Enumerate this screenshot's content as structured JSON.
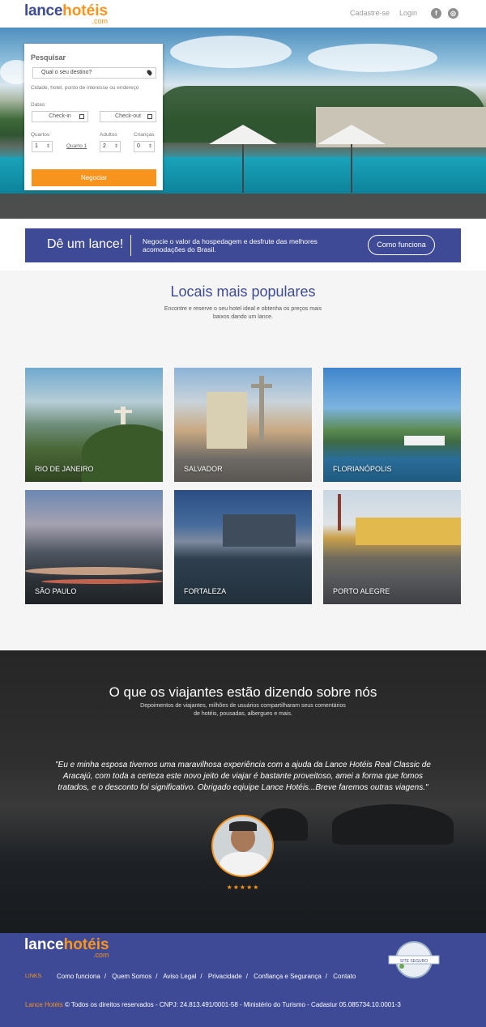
{
  "header": {
    "logo": {
      "part1": "lance",
      "part2": "hotéis",
      "part3": ".com"
    },
    "signup": "Cadastre-se",
    "login": "Login",
    "social": [
      {
        "name": "facebook",
        "glyph": "f"
      },
      {
        "name": "instagram",
        "glyph": "◎"
      }
    ]
  },
  "search": {
    "title": "Pesquisar",
    "destination_placeholder": "Qual o seu destino?",
    "destination_hint": "Cidade, hotel, ponto de interesse ou endereço",
    "dates_label": "Datas:",
    "checkin": "Check-in",
    "checkout": "Check-out",
    "rooms_label": "Quartos",
    "adults_label": "Adultos",
    "children_label": "Crianças",
    "rooms_value": "1",
    "adults_value": "2",
    "children_value": "0",
    "room_link": "Quarto 1",
    "submit": "Negociar"
  },
  "banner": {
    "title": "Dê um lance!",
    "text": "Negocie o valor da hospedagem e desfrute das melhores acomodações do Brasil.",
    "button": "Como funciona"
  },
  "popular": {
    "title": "Locais mais populares",
    "subtitle": "Encontre e reserve o seu hotel ideal e obtenha os preços mais baixos dando um lance.",
    "cities": [
      "RIO DE JANEIRO",
      "SALVADOR",
      "FLORIANÓPOLIS",
      "SÃO PAULO",
      "FORTALEZA",
      "PORTO ALEGRE"
    ]
  },
  "testimonials": {
    "title": "O que os viajantes estão dizendo sobre nós",
    "subtitle": "Depoimentos de viajantes, milhões de usuários compartilharam seus comentários de hotéis, pousadas, albergues e mais.",
    "quote": "\"Eu e minha esposa tivemos uma maravilhosa experiência com a ajuda da Lance Hotéis Real Classic de Aracajú, com toda a certeza este novo jeito de viajar é bastante proveitoso, amei a forma que fomos tratados, e o desconto foi significativo. Obrigado eqiuipe Lance Hotéis...Breve faremos outras viagens.\"",
    "rating": 5,
    "stars": "★★★★★"
  },
  "footer": {
    "logo": {
      "part1": "lance",
      "part2": "hotéis",
      "part3": ".com"
    },
    "links_label": "LINKS",
    "links": [
      "Como funciona",
      "Quem Somos",
      "Aviso Legal",
      "Privacidade",
      "Confiança e Segurança",
      "Contato"
    ],
    "copyright_brand": "Lance Hotéis",
    "copyright": "© Todos os direitos reservados - CNPJ: 24.813.491/0001-58 - Ministério do Turismo - Cadastur 05.085734.10.0001-3",
    "seal_text": "SITE SEGURO"
  },
  "colors": {
    "brand_blue": "#3e4a96",
    "brand_orange": "#f7941d"
  }
}
